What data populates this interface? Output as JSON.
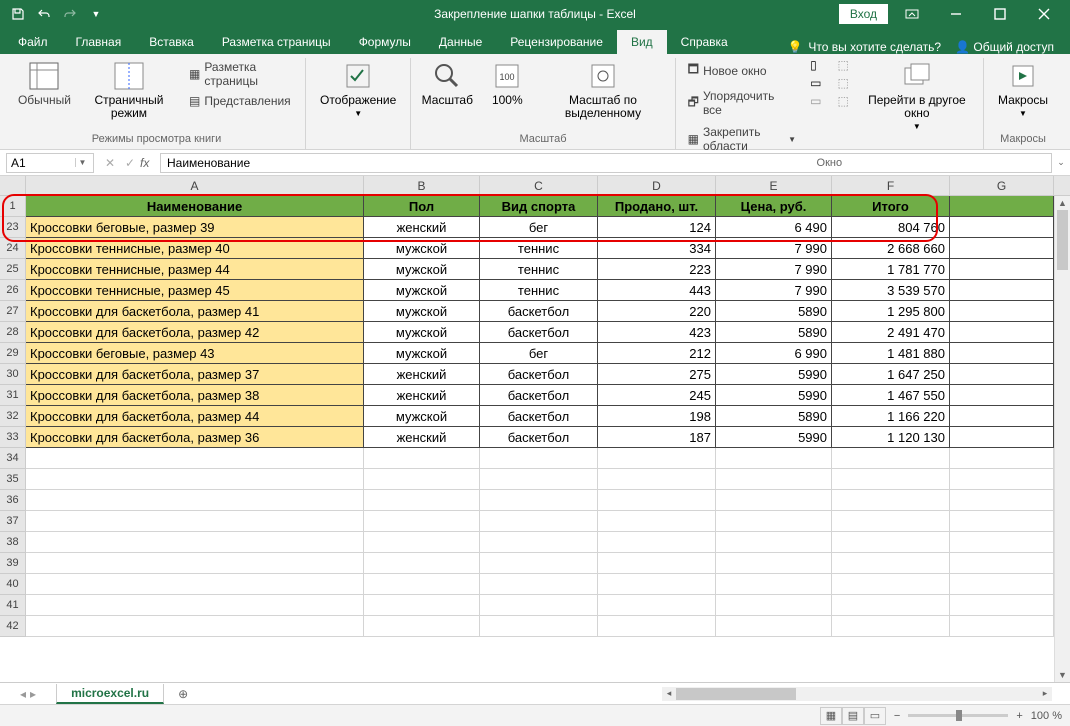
{
  "titlebar": {
    "title": "Закрепление шапки таблицы  -  Excel",
    "login": "Вход"
  },
  "tabs": {
    "file": "Файл",
    "home": "Главная",
    "insert": "Вставка",
    "layout": "Разметка страницы",
    "formulas": "Формулы",
    "data": "Данные",
    "review": "Рецензирование",
    "view": "Вид",
    "help": "Справка",
    "tellme": "Что вы хотите сделать?",
    "share": "Общий доступ"
  },
  "ribbon": {
    "normal": "Обычный",
    "pagebreak": "Страничный режим",
    "page_layout": "Разметка страницы",
    "custom_views": "Представления",
    "group_views": "Режимы просмотра книги",
    "show": "Отображение",
    "zoom": "Масштаб",
    "zoom100": "100%",
    "zoom_selection": "Масштаб по выделенному",
    "group_zoom": "Масштаб",
    "new_window": "Новое окно",
    "arrange_all": "Упорядочить все",
    "freeze_panes": "Закрепить области",
    "switch_windows": "Перейти в другое окно",
    "group_window": "Окно",
    "macros": "Макросы",
    "group_macros": "Макросы"
  },
  "formula_bar": {
    "name_box": "A1",
    "formula": "Наименование"
  },
  "columns": [
    "A",
    "B",
    "C",
    "D",
    "E",
    "F",
    "G"
  ],
  "header_row": {
    "num": "1",
    "cells": [
      "Наименование",
      "Пол",
      "Вид спорта",
      "Продано, шт.",
      "Цена, руб.",
      "Итого"
    ]
  },
  "data_rows": [
    {
      "num": "23",
      "cells": [
        "Кроссовки беговые, размер 39",
        "женский",
        "бег",
        "124",
        "6 490",
        "804 760"
      ]
    },
    {
      "num": "24",
      "cells": [
        "Кроссовки теннисные, размер 40",
        "мужской",
        "теннис",
        "334",
        "7 990",
        "2 668 660"
      ]
    },
    {
      "num": "25",
      "cells": [
        "Кроссовки теннисные, размер 44",
        "мужской",
        "теннис",
        "223",
        "7 990",
        "1 781 770"
      ]
    },
    {
      "num": "26",
      "cells": [
        "Кроссовки теннисные, размер 45",
        "мужской",
        "теннис",
        "443",
        "7 990",
        "3 539 570"
      ]
    },
    {
      "num": "27",
      "cells": [
        "Кроссовки для баскетбола, размер 41",
        "мужской",
        "баскетбол",
        "220",
        "5890",
        "1 295 800"
      ]
    },
    {
      "num": "28",
      "cells": [
        "Кроссовки для баскетбола, размер 42",
        "мужской",
        "баскетбол",
        "423",
        "5890",
        "2 491 470"
      ]
    },
    {
      "num": "29",
      "cells": [
        "Кроссовки беговые, размер 43",
        "мужской",
        "бег",
        "212",
        "6 990",
        "1 481 880"
      ]
    },
    {
      "num": "30",
      "cells": [
        "Кроссовки для баскетбола, размер 37",
        "женский",
        "баскетбол",
        "275",
        "5990",
        "1 647 250"
      ]
    },
    {
      "num": "31",
      "cells": [
        "Кроссовки для баскетбола, размер 38",
        "женский",
        "баскетбол",
        "245",
        "5990",
        "1 467 550"
      ]
    },
    {
      "num": "32",
      "cells": [
        "Кроссовки для баскетбола, размер 44",
        "мужской",
        "баскетбол",
        "198",
        "5890",
        "1 166 220"
      ]
    },
    {
      "num": "33",
      "cells": [
        "Кроссовки для баскетбола, размер 36",
        "женский",
        "баскетбол",
        "187",
        "5990",
        "1 120 130"
      ]
    }
  ],
  "empty_rows": [
    "34",
    "35",
    "36",
    "37",
    "38",
    "39",
    "40",
    "41",
    "42"
  ],
  "sheet": {
    "name": "microexcel.ru"
  },
  "status": {
    "zoom": "100 %"
  }
}
